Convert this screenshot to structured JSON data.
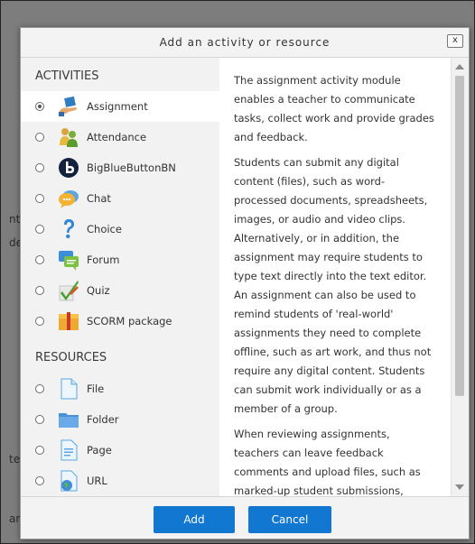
{
  "background_fragments": [
    "nt",
    "de",
    "te",
    "an"
  ],
  "dialog": {
    "title": "Add an activity or resource",
    "close_label": "x"
  },
  "activities": {
    "heading": "ACTIVITIES",
    "items": [
      {
        "label": "Assignment",
        "icon": "assignment-icon",
        "selected": true
      },
      {
        "label": "Attendance",
        "icon": "attendance-icon",
        "selected": false
      },
      {
        "label": "BigBlueButtonBN",
        "icon": "bigbluebutton-icon",
        "selected": false
      },
      {
        "label": "Chat",
        "icon": "chat-icon",
        "selected": false
      },
      {
        "label": "Choice",
        "icon": "choice-icon",
        "selected": false
      },
      {
        "label": "Forum",
        "icon": "forum-icon",
        "selected": false
      },
      {
        "label": "Quiz",
        "icon": "quiz-icon",
        "selected": false
      },
      {
        "label": "SCORM package",
        "icon": "scorm-package-icon",
        "selected": false
      }
    ]
  },
  "resources": {
    "heading": "RESOURCES",
    "items": [
      {
        "label": "File",
        "icon": "file-icon",
        "selected": false
      },
      {
        "label": "Folder",
        "icon": "folder-icon",
        "selected": false
      },
      {
        "label": "Page",
        "icon": "page-icon",
        "selected": false
      },
      {
        "label": "URL",
        "icon": "url-icon",
        "selected": false
      }
    ]
  },
  "description": {
    "paragraphs": [
      "The assignment activity module enables a teacher to communicate tasks, collect work and provide grades and feedback.",
      "Students can submit any digital content (files), such as word-processed documents, spreadsheets, images, or audio and video clips. Alternatively, or in addition, the assignment may require students to type text directly into the text editor. An assignment can also be used to remind students of 'real-world' assignments they need to complete offline, such as art work, and thus not require any digital content. Students can submit work individually or as a member of a group.",
      "When reviewing assignments, teachers can leave feedback comments and upload files, such as marked-up student submissions, documents with comments or spoken audio feedback. Assignments"
    ]
  },
  "footer": {
    "add_label": "Add",
    "cancel_label": "Cancel"
  },
  "colors": {
    "primary_button": "#1177d1",
    "panel_gray": "#f2f2f2"
  }
}
